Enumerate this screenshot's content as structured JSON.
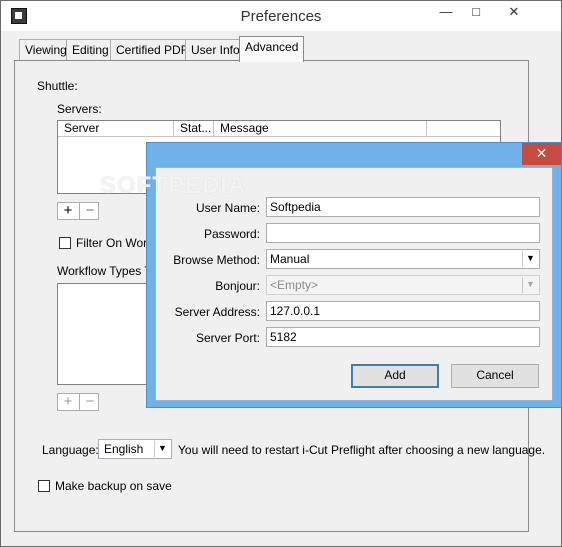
{
  "window": {
    "title": "Preferences",
    "min_glyph": "—",
    "max_glyph": "□",
    "close_glyph": "✕"
  },
  "tabs": [
    {
      "label": "Viewing"
    },
    {
      "label": "Editing"
    },
    {
      "label": "Certified PDF"
    },
    {
      "label": "User Info"
    },
    {
      "label": "Advanced",
      "active": true
    }
  ],
  "advanced": {
    "shuttle_label": "Shuttle:",
    "servers_label": "Servers:",
    "servers_columns": [
      "Server",
      "Stat...",
      "Message"
    ],
    "add_glyph": "+",
    "remove_glyph": "−",
    "filter_label": "Filter On Workfl",
    "workflow_types_label": "Workflow Types To",
    "language_label": "Language:",
    "language_value": "English",
    "language_note": "You will need to restart i-Cut Preflight after choosing a new language.",
    "backup_label": "Make backup on save",
    "filter_checked": false,
    "backup_checked": false
  },
  "dialog": {
    "close_glyph": "✕",
    "fields": {
      "user_name": {
        "label": "User Name:",
        "value": "Softpedia"
      },
      "password": {
        "label": "Password:",
        "value": ""
      },
      "browse_method": {
        "label": "Browse Method:",
        "value": "Manual"
      },
      "bonjour": {
        "label": "Bonjour:",
        "value": "<Empty>"
      },
      "server_address": {
        "label": "Server Address:",
        "value": "127.0.0.1"
      },
      "server_port": {
        "label": "Server Port:",
        "value": "5182"
      }
    },
    "add_label": "Add",
    "cancel_label": "Cancel"
  },
  "watermark": "SOFTPEDIA",
  "colors": {
    "dialog_frame": "#6fb1e8",
    "close_red": "#c74b3f",
    "default_button_border": "#3c7fb1"
  }
}
